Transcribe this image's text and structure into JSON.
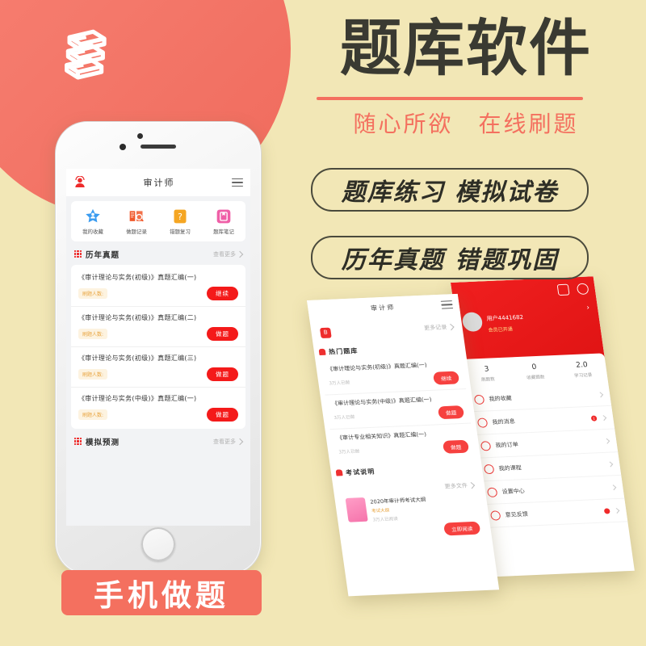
{
  "brand": {
    "logo_icon": "stacked-books-icon"
  },
  "hero": {
    "title": "题库软件",
    "subtitle": "随心所欲　在线刷题",
    "pills": [
      "题库练习 模拟试卷",
      "历年真题 错题巩固"
    ],
    "accent_color": "#f4705f",
    "background_color": "#f2e7b6"
  },
  "footer_label": {
    "text": "手机做题",
    "background_color": "#f4705f"
  },
  "phone": {
    "app": {
      "header": {
        "title": "审计师",
        "avatar_icon": "user-avatar-icon",
        "menu_icon": "hamburger-icon"
      },
      "quick_actions": [
        {
          "label": "我的收藏",
          "icon": "star-badge-icon",
          "color": "#3b9cf0"
        },
        {
          "label": "做题记录",
          "icon": "book-search-icon",
          "color": "#f0582a"
        },
        {
          "label": "错题复习",
          "icon": "question-board-icon",
          "color": "#f5a623"
        },
        {
          "label": "题库笔记",
          "icon": "note-icon",
          "color": "#ef5fa7"
        }
      ],
      "sections": [
        {
          "title": "历年真题",
          "more_label": "查看更多",
          "icon": "grid-dots-icon",
          "rows": [
            {
              "title": "《审计理论与实务(初级)》真题汇编(一)",
              "tag": "刷题人数:",
              "action": "继续"
            },
            {
              "title": "《审计理论与实务(初级)》真题汇编(二)",
              "tag": "刷题人数:",
              "action": "做题"
            },
            {
              "title": "《审计理论与实务(初级)》真题汇编(三)",
              "tag": "刷题人数:",
              "action": "做题"
            },
            {
              "title": "《审计理论与实务(中级)》真题汇编(一)",
              "tag": "刷题人数:",
              "action": "做题"
            }
          ]
        },
        {
          "title": "模拟预测",
          "more_label": "查看更多",
          "icon": "grid-dots-icon",
          "rows": []
        }
      ]
    }
  },
  "shot_middle": {
    "header": {
      "title": "审计师",
      "menu_icon": "hamburger-icon"
    },
    "banner": {
      "icon": "badge-icon",
      "more_label": "更多记录"
    },
    "section": {
      "title": "热门题库",
      "icon": "bell-icon"
    },
    "rows": [
      {
        "title": "《审计理论与实务(初级)》真题汇编(一)",
        "sub": "3万人已做",
        "action": "继续"
      },
      {
        "title": "《审计理论与实务(中级)》真题汇编(一)",
        "sub": "3万人已做",
        "action": "做题"
      },
      {
        "title": "《审计专业相关知识》真题汇编(一)",
        "sub": "3万人已做",
        "action": "做题"
      }
    ],
    "doc_section": {
      "title": "考试说明",
      "more_label": "更多文件"
    },
    "doc": {
      "title": "2020年审计师考试大纲",
      "tag": "考试大纲",
      "sub": "3万人已阅读",
      "action": "立即阅读",
      "icon": "document-icon"
    }
  },
  "shot_right": {
    "username": "用户4441682",
    "vip_label": "会员已开通",
    "scan_icon": "scan-icon",
    "settings_icon": "gear-icon",
    "message_icon": "message-icon",
    "stats": [
      {
        "value": "3",
        "label": "刷题数"
      },
      {
        "value": "0",
        "label": "收藏题数"
      },
      {
        "value": "2.0",
        "label": "学习记录"
      }
    ],
    "menu": [
      {
        "label": "我的收藏",
        "icon": "heart-icon",
        "badge": ""
      },
      {
        "label": "我的消息",
        "icon": "message-icon",
        "badge": "1"
      },
      {
        "label": "我的订单",
        "icon": "order-icon",
        "badge": ""
      },
      {
        "label": "我的课程",
        "icon": "course-icon",
        "badge": ""
      },
      {
        "label": "设置中心",
        "icon": "gear-icon",
        "badge": ""
      },
      {
        "label": "意见反馈",
        "icon": "feedback-icon",
        "badge": ""
      }
    ]
  }
}
